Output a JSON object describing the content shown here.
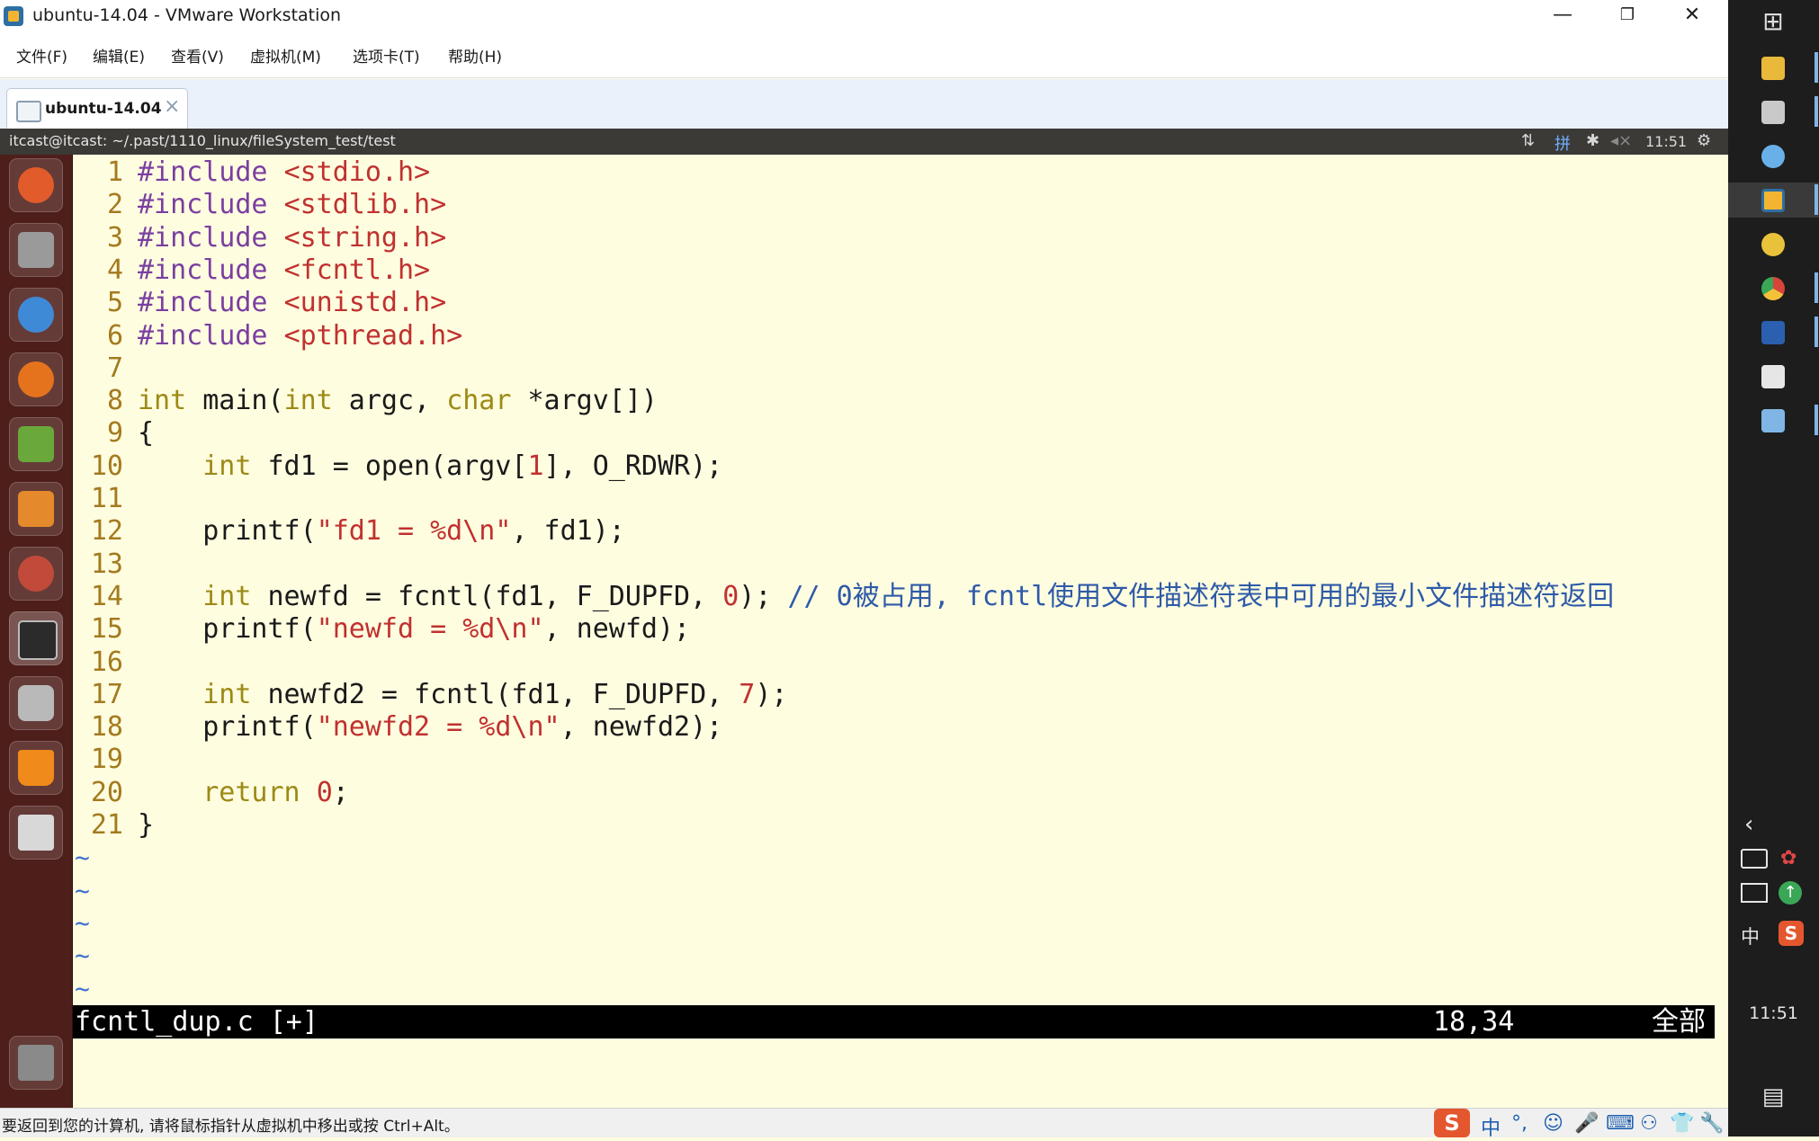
{
  "window": {
    "title": "ubuntu-14.04 - VMware Workstation",
    "controls": {
      "minimize": "—",
      "restore": "❐",
      "close": "✕"
    }
  },
  "menu": [
    {
      "label": "文件(F)"
    },
    {
      "label": "编辑(E)"
    },
    {
      "label": "查看(V)"
    },
    {
      "label": "虚拟机(M)"
    },
    {
      "label": "选项卡(T)"
    },
    {
      "label": "帮助(H)"
    }
  ],
  "vm_tab": {
    "label": "ubuntu-14.04",
    "close": "×"
  },
  "ubuntu_panel": {
    "terminal_title": "itcast@itcast: ~/.past/1110_linux/fileSystem_test/test",
    "input_method": "拼",
    "clock": "11:51"
  },
  "launcher": [
    {
      "name": "dash-icon",
      "color": "#e25b2b"
    },
    {
      "name": "files-icon",
      "color": "#9a9a9a"
    },
    {
      "name": "chrome-icon",
      "color": "#3f8ad6"
    },
    {
      "name": "firefox-icon",
      "color": "#e5731e"
    },
    {
      "name": "book-icon",
      "color": "#6aa83b"
    },
    {
      "name": "sublime-icon",
      "color": "#e58a2c"
    },
    {
      "name": "settings-icon",
      "color": "#c24a3a"
    },
    {
      "name": "terminal-icon",
      "color": "#2b2b2b"
    },
    {
      "name": "speaker-icon",
      "color": "#b9b9b9"
    },
    {
      "name": "vlc-icon",
      "color": "#f08a1a"
    },
    {
      "name": "save-icon",
      "color": "#d8d8d8"
    },
    {
      "name": "trash-icon",
      "color": "#8a8a8a"
    }
  ],
  "code": {
    "lines": [
      {
        "n": "1",
        "tokens": [
          {
            "t": "#include ",
            "c": "pp"
          },
          {
            "t": "<stdio.h>",
            "c": "inc"
          }
        ]
      },
      {
        "n": "2",
        "tokens": [
          {
            "t": "#include ",
            "c": "pp"
          },
          {
            "t": "<stdlib.h>",
            "c": "inc"
          }
        ]
      },
      {
        "n": "3",
        "tokens": [
          {
            "t": "#include ",
            "c": "pp"
          },
          {
            "t": "<string.h>",
            "c": "inc"
          }
        ]
      },
      {
        "n": "4",
        "tokens": [
          {
            "t": "#include ",
            "c": "pp"
          },
          {
            "t": "<fcntl.h>",
            "c": "inc"
          }
        ]
      },
      {
        "n": "5",
        "tokens": [
          {
            "t": "#include ",
            "c": "pp"
          },
          {
            "t": "<unistd.h>",
            "c": "inc"
          }
        ]
      },
      {
        "n": "6",
        "tokens": [
          {
            "t": "#include ",
            "c": "pp"
          },
          {
            "t": "<pthread.h>",
            "c": "inc"
          }
        ]
      },
      {
        "n": "7",
        "tokens": []
      },
      {
        "n": "8",
        "tokens": [
          {
            "t": "int",
            "c": "ty"
          },
          {
            "t": " main(",
            "c": ""
          },
          {
            "t": "int",
            "c": "ty"
          },
          {
            "t": " argc, ",
            "c": ""
          },
          {
            "t": "char",
            "c": "ty"
          },
          {
            "t": " *argv[])",
            "c": ""
          }
        ]
      },
      {
        "n": "9",
        "tokens": [
          {
            "t": "{",
            "c": ""
          }
        ]
      },
      {
        "n": "10",
        "tokens": [
          {
            "t": "    ",
            "c": ""
          },
          {
            "t": "int",
            "c": "ty"
          },
          {
            "t": " fd1 = open(argv[",
            "c": ""
          },
          {
            "t": "1",
            "c": "num"
          },
          {
            "t": "], O_RDWR);",
            "c": ""
          }
        ]
      },
      {
        "n": "11",
        "tokens": []
      },
      {
        "n": "12",
        "tokens": [
          {
            "t": "    printf(",
            "c": ""
          },
          {
            "t": "\"fd1 = %d\\n\"",
            "c": "str"
          },
          {
            "t": ", fd1);",
            "c": ""
          }
        ]
      },
      {
        "n": "13",
        "tokens": []
      },
      {
        "n": "14",
        "tokens": [
          {
            "t": "    ",
            "c": ""
          },
          {
            "t": "int",
            "c": "ty"
          },
          {
            "t": " newfd = fcntl(fd1, F_DUPFD, ",
            "c": ""
          },
          {
            "t": "0",
            "c": "num"
          },
          {
            "t": "); ",
            "c": ""
          },
          {
            "t": "// 0被占用, fcntl使用文件描述符表中可用的最小文件描述符返回",
            "c": "cm"
          }
        ]
      },
      {
        "n": "15",
        "tokens": [
          {
            "t": "    printf(",
            "c": ""
          },
          {
            "t": "\"newfd = %d\\n\"",
            "c": "str"
          },
          {
            "t": ", newfd);",
            "c": ""
          }
        ]
      },
      {
        "n": "16",
        "tokens": []
      },
      {
        "n": "17",
        "tokens": [
          {
            "t": "    ",
            "c": ""
          },
          {
            "t": "int",
            "c": "ty"
          },
          {
            "t": " newfd2 = fcntl(fd1, F_DUPFD, ",
            "c": ""
          },
          {
            "t": "7",
            "c": "num"
          },
          {
            "t": ");",
            "c": ""
          }
        ]
      },
      {
        "n": "18",
        "tokens": [
          {
            "t": "    printf(",
            "c": ""
          },
          {
            "t": "\"newfd2 = %d\\n\"",
            "c": "str"
          },
          {
            "t": ", newfd2);",
            "c": ""
          }
        ]
      },
      {
        "n": "19",
        "tokens": []
      },
      {
        "n": "20",
        "tokens": [
          {
            "t": "    ",
            "c": ""
          },
          {
            "t": "return",
            "c": "ty"
          },
          {
            "t": " ",
            "c": ""
          },
          {
            "t": "0",
            "c": "num"
          },
          {
            "t": ";",
            "c": ""
          }
        ]
      },
      {
        "n": "21",
        "tokens": [
          {
            "t": "}",
            "c": ""
          }
        ]
      }
    ],
    "tilde": "~",
    "tilde_count": 5
  },
  "vim_status": {
    "file": "fcntl_dup.c [+]",
    "position": "18,34",
    "scope": "全部"
  },
  "vmware_status": {
    "hint": "要返回到您的计算机, 请将鼠标指针从虚拟机中移出或按 Ctrl+Alt。",
    "ime_lang": "中"
  },
  "taskbar": {
    "clock": "11:51",
    "ime_lang": "中",
    "apps": [
      {
        "name": "explorer-icon",
        "color": "#e8b93a"
      },
      {
        "name": "chat-icon",
        "color": "#c9c9c9"
      },
      {
        "name": "paint-icon",
        "color": "#6ab0e8"
      },
      {
        "name": "vmware-icon",
        "color": "#f3b531"
      },
      {
        "name": "sketch-icon",
        "color": "#e8c23a"
      },
      {
        "name": "chrome-icon",
        "color": "#d8443a"
      },
      {
        "name": "word-icon",
        "color": "#2b5fb0"
      },
      {
        "name": "photos-icon",
        "color": "#e6e6e6"
      },
      {
        "name": "notes-icon",
        "color": "#7fb6e6"
      }
    ]
  }
}
